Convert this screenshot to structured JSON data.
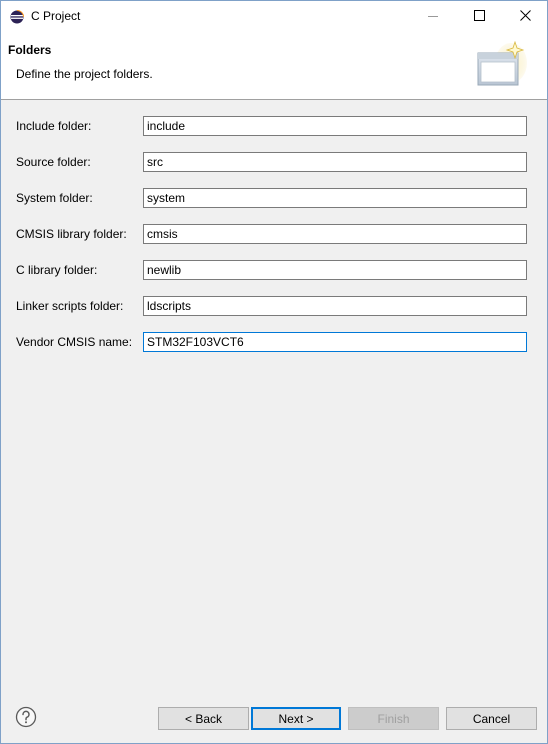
{
  "window": {
    "title": "C Project",
    "icons": {
      "app": "eclipse-icon",
      "minimize": "minimize-icon",
      "maximize": "maximize-icon",
      "close": "close-icon"
    }
  },
  "banner": {
    "title": "Folders",
    "description": "Define the project folders.",
    "image": "wizard-banner-icon"
  },
  "fields": [
    {
      "label": "Include folder:",
      "value": "include"
    },
    {
      "label": "Source folder:",
      "value": "src"
    },
    {
      "label": "System folder:",
      "value": "system"
    },
    {
      "label": "CMSIS library folder:",
      "value": "cmsis"
    },
    {
      "label": "C library folder:",
      "value": "newlib"
    },
    {
      "label": "Linker scripts folder:",
      "value": "ldscripts"
    },
    {
      "label": "Vendor CMSIS name:",
      "value": "STM32F103VCT6"
    }
  ],
  "footer": {
    "help_icon": "help-icon",
    "back_label": "< Back",
    "next_label": "Next >",
    "finish_label": "Finish",
    "cancel_label": "Cancel"
  },
  "colors": {
    "focus_border": "#0078d7",
    "window_border": "#7fa1c8",
    "background": "#f0f0f0"
  }
}
